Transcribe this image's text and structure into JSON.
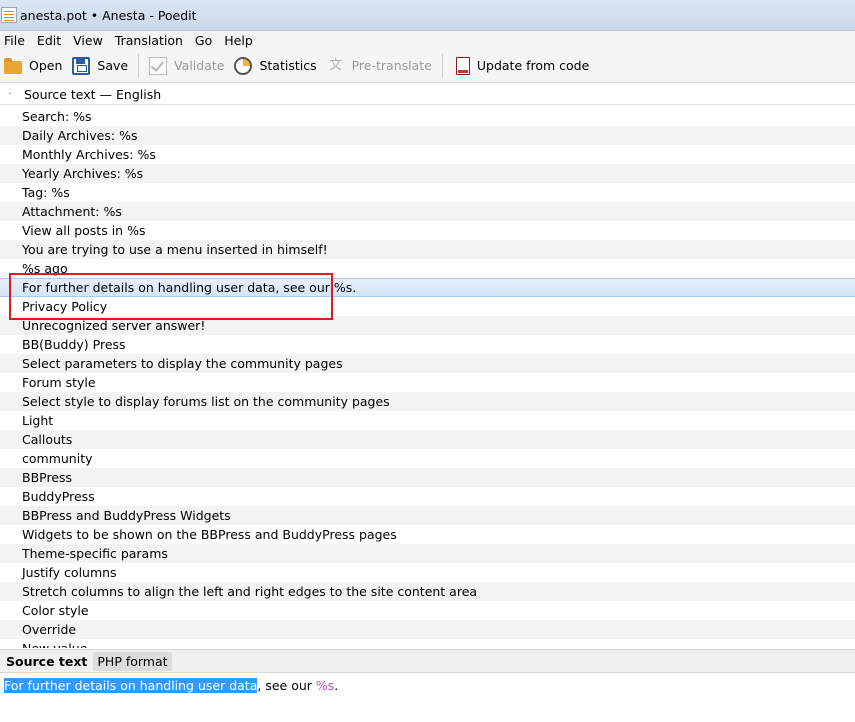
{
  "window": {
    "title": "anesta.pot • Anesta - Poedit",
    "icon": "document-list-icon"
  },
  "menu": [
    "File",
    "Edit",
    "View",
    "Translation",
    "Go",
    "Help"
  ],
  "toolbar": {
    "open": "Open",
    "save": "Save",
    "validate": "Validate",
    "statistics": "Statistics",
    "pretranslate": "Pre-translate",
    "update": "Update from code"
  },
  "list_header": {
    "marker": "·",
    "label": "Source text — English"
  },
  "rows": [
    "Search: %s",
    "Daily Archives: %s",
    "Monthly Archives: %s",
    "Yearly Archives: %s",
    "Tag: %s",
    "Attachment: %s",
    "View all posts in %s",
    "You are trying to use a menu inserted in himself!",
    "%s ago",
    "For further details on handling user data, see our %s.",
    "Privacy Policy",
    "Unrecognized server answer!",
    "BB(Buddy) Press",
    "Select parameters to display the community pages",
    "Forum style",
    "Select style to display forums list on the community pages",
    "Light",
    "Callouts",
    "community",
    "BBPress",
    "BuddyPress",
    "BBPress and BuddyPress Widgets",
    "Widgets to be shown on the BBPress and BuddyPress pages",
    "Theme-specific params",
    "Justify columns",
    "Stretch columns to align the left and right edges to the site content area",
    "Color style",
    "Override",
    "New value"
  ],
  "selected_index": 9,
  "bottom_tabs": {
    "source": "Source text",
    "format": "PHP format"
  },
  "preview": {
    "selected": "For further details on handling user data",
    "rest": ", see our ",
    "placeholder": "%s",
    "end": "."
  },
  "colors": {
    "highlight_box": "#e01b1b",
    "selection": "#3399ff",
    "placeholder": "#b24fc7"
  }
}
